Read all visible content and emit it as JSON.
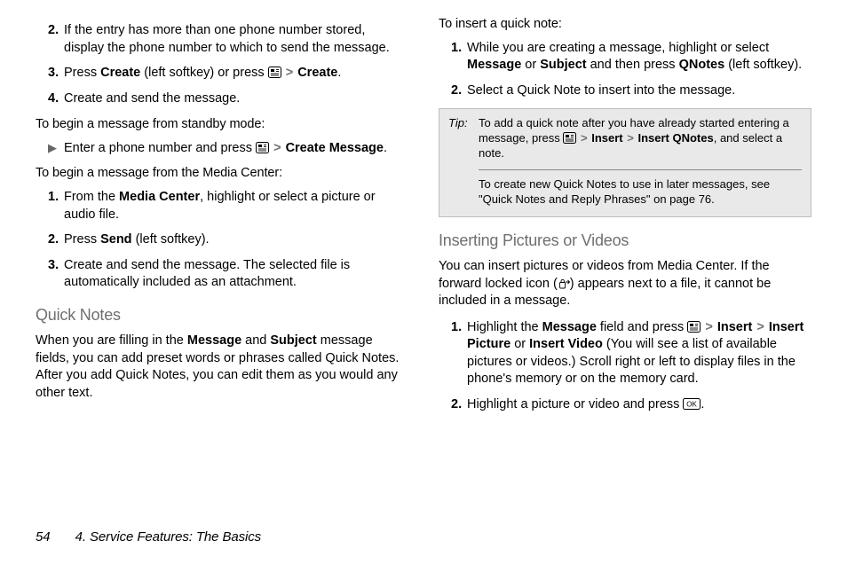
{
  "left": {
    "steps_a": [
      {
        "n": "2.",
        "html": "If the entry has more than one phone number stored, display the phone number to which to send the message."
      },
      {
        "n": "3.",
        "html": "Press <b>Create</b> (left softkey) or press {MENU} <span class=\"gt\">&gt;</span> <b>Create</b>."
      },
      {
        "n": "4.",
        "html": "Create and send the message."
      }
    ],
    "lead1": "To begin a message from standby mode:",
    "bullet1": "Enter a phone number and press {MENU} <span class=\"gt\">&gt;</span> <b>Create Message</b>.",
    "lead2": "To begin a message from the Media Center:",
    "steps_b": [
      {
        "n": "1.",
        "html": "From the <b>Media Center</b>, highlight or select a picture or audio file."
      },
      {
        "n": "2.",
        "html": "Press <b>Send</b> (left softkey)."
      },
      {
        "n": "3.",
        "html": "Create and send the message. The selected file is automatically included as an attachment."
      }
    ],
    "h1": "Quick Notes",
    "p1": "When you are filling in the <b>Message</b> and <b>Subject</b> message fields, you can add preset words or phrases called Quick Notes. After you add Quick Notes, you can edit them as you would any other text."
  },
  "right": {
    "lead1": "To insert a quick note:",
    "steps_a": [
      {
        "n": "1.",
        "html": "While you are creating a message, highlight or select <b>Message</b> or <b>Subject</b> and then press <b>QNotes</b> (left softkey)."
      },
      {
        "n": "2.",
        "html": "Select a Quick Note to insert into the message."
      }
    ],
    "tip_label": "Tip:",
    "tip1": "To add a quick note after you have already started entering a message, press {MENU} <span class=\"gt\">&gt;</span> <b>Insert</b> <span class=\"gt\">&gt;</span> <b>Insert QNotes</b>, and select a note.",
    "tip2": "To create new Quick Notes to use in later messages, see \"Quick Notes and Reply Phrases\" on page 76.",
    "h1": "Inserting Pictures or Videos",
    "p1": "You can insert pictures or videos from Media Center. If the forward locked icon ({LOCK}) appears next to a file, it cannot be included in a message.",
    "steps_b": [
      {
        "n": "1.",
        "html": "Highlight the <b>Message</b> field and press {MENU} <span class=\"gt\">&gt;</span> <b>Insert</b> <span class=\"gt\">&gt;</span> <b>Insert Picture</b> or <b>Insert Video</b> (You will see a list of available pictures or videos.) Scroll right or left to display files in the phone's memory or on the memory card."
      },
      {
        "n": "2.",
        "html": "Highlight a picture or video and press {OK}."
      }
    ]
  },
  "footer": {
    "page": "54",
    "title": "4. Service Features: The Basics"
  },
  "chart_data": null
}
